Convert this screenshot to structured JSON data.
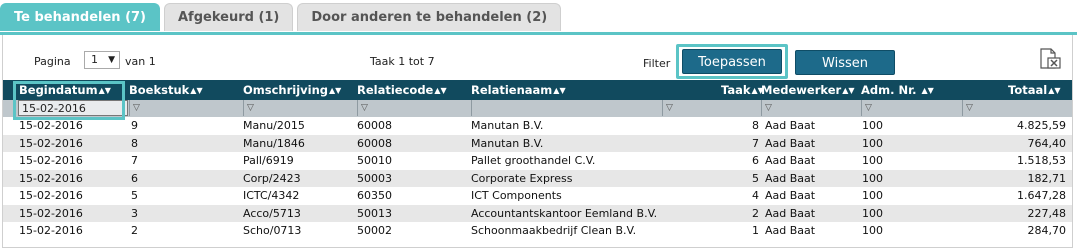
{
  "tabs": [
    {
      "label": "Te behandelen (7)",
      "active": true
    },
    {
      "label": "Afgekeurd (1)",
      "active": false
    },
    {
      "label": "Door anderen te behandelen (2)",
      "active": false
    }
  ],
  "toolbar": {
    "page_label": "Pagina",
    "page_value": "1",
    "page_of": "van 1",
    "task_range": "Taak 1 tot 7",
    "filter_label": "Filter",
    "apply_label": "Toepassen",
    "clear_label": "Wissen",
    "export_icon": "excel-export-icon"
  },
  "columns": [
    {
      "label": "Begindatum"
    },
    {
      "label": "Boekstuk"
    },
    {
      "label": "Omschrijving"
    },
    {
      "label": "Relatiecode"
    },
    {
      "label": "Relatienaam"
    },
    {
      "label": "Taak"
    },
    {
      "label": "Medewerker"
    },
    {
      "label": "Adm. Nr."
    },
    {
      "label": "Totaal"
    }
  ],
  "filters": {
    "begindatum": "15-02-2016",
    "filter_icon": "▽"
  },
  "rows": [
    {
      "begindatum": "15-02-2016",
      "boekstuk": "9",
      "omschrijving": "Manu/2015",
      "relatiecode": "60008",
      "relatienaam": "Manutan B.V.",
      "taak": "8",
      "medewerker": "Aad Baat",
      "adm": "100",
      "totaal": "4.825,59"
    },
    {
      "begindatum": "15-02-2016",
      "boekstuk": "8",
      "omschrijving": "Manu/1846",
      "relatiecode": "60008",
      "relatienaam": "Manutan B.V.",
      "taak": "7",
      "medewerker": "Aad Baat",
      "adm": "100",
      "totaal": "764,40"
    },
    {
      "begindatum": "15-02-2016",
      "boekstuk": "7",
      "omschrijving": "Pall/6919",
      "relatiecode": "50010",
      "relatienaam": "Pallet groothandel C.V.",
      "taak": "6",
      "medewerker": "Aad Baat",
      "adm": "100",
      "totaal": "1.518,53"
    },
    {
      "begindatum": "15-02-2016",
      "boekstuk": "6",
      "omschrijving": "Corp/2423",
      "relatiecode": "50003",
      "relatienaam": "Corporate Express",
      "taak": "5",
      "medewerker": "Aad Baat",
      "adm": "100",
      "totaal": "182,71"
    },
    {
      "begindatum": "15-02-2016",
      "boekstuk": "5",
      "omschrijving": "ICTC/4342",
      "relatiecode": "60350",
      "relatienaam": "ICT Components",
      "taak": "4",
      "medewerker": "Aad Baat",
      "adm": "100",
      "totaal": "1.647,28"
    },
    {
      "begindatum": "15-02-2016",
      "boekstuk": "3",
      "omschrijving": "Acco/5713",
      "relatiecode": "50013",
      "relatienaam": "Accountantskantoor Eemland B.V.",
      "taak": "2",
      "medewerker": "Aad Baat",
      "adm": "100",
      "totaal": "227,48"
    },
    {
      "begindatum": "15-02-2016",
      "boekstuk": "2",
      "omschrijving": "Scho/0713",
      "relatiecode": "50002",
      "relatienaam": "Schoonmaakbedrijf Clean B.V.",
      "taak": "1",
      "medewerker": "Aad Baat",
      "adm": "100",
      "totaal": "284,70"
    }
  ],
  "colors": {
    "accent": "#5bc4c6",
    "header_bg": "#114a5e",
    "button_bg": "#1d6a8a"
  }
}
